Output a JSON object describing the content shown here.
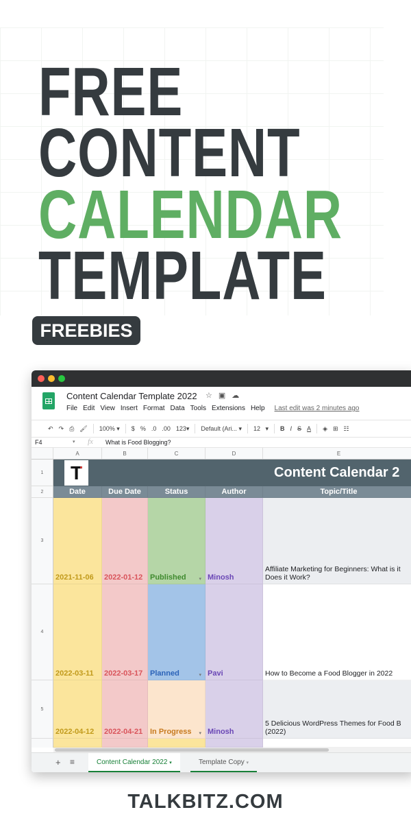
{
  "headline": {
    "line1": "FREE",
    "line2": "CONTENT",
    "line3": "CALENDAR",
    "line4": "TEMPLATE"
  },
  "badge": "FREEBIES",
  "colors": {
    "dark": "#353b3f",
    "green": "#5fae63"
  },
  "sheet": {
    "title": "Content Calendar Template 2022",
    "title_icons": [
      "star-icon",
      "move-to-folder-icon",
      "cloud-status-icon"
    ],
    "menu": [
      "File",
      "Edit",
      "View",
      "Insert",
      "Format",
      "Data",
      "Tools",
      "Extensions",
      "Help"
    ],
    "last_edit": "Last edit was 2 minutes ago",
    "toolbar": {
      "zoom": "100%",
      "currency": "$",
      "percent": "%",
      "dec_less": ".0",
      "dec_more": ".00",
      "format": "123",
      "font": "Default (Ari...",
      "size": "12",
      "bold": "B",
      "italic": "I",
      "strike": "S",
      "text_color": "A"
    },
    "cell_ref": "F4",
    "fx": "fx",
    "formula": "What is Food Blogging?",
    "columns": [
      "A",
      "B",
      "C",
      "D",
      "E"
    ],
    "row_numbers": [
      "1",
      "2",
      "3",
      "4",
      "5"
    ],
    "banner_title": "Content Calendar 2",
    "headers": [
      "Date",
      "Due Date",
      "Status",
      "Author",
      "Topic/Title"
    ],
    "rows": [
      {
        "date": "2021-11-06",
        "due": "2022-01-12",
        "status": "Published",
        "author": "Minosh",
        "topic": "Affiliate Marketing for Beginners: What is it Does it Work?"
      },
      {
        "date": "2022-03-11",
        "due": "2022-03-17",
        "status": "Planned",
        "author": "Pavi",
        "topic": "How to Become a Food Blogger in 2022"
      },
      {
        "date": "2022-04-12",
        "due": "2022-04-21",
        "status": "In Progress",
        "author": "Minosh",
        "topic": "5 Delicious WordPress Themes for Food B (2022)"
      }
    ],
    "tabs": [
      "Content Calendar 2022",
      "Template Copy"
    ],
    "add_sheet": "+",
    "sheet_list": "≡"
  },
  "footer": "TALKBITZ.COM"
}
